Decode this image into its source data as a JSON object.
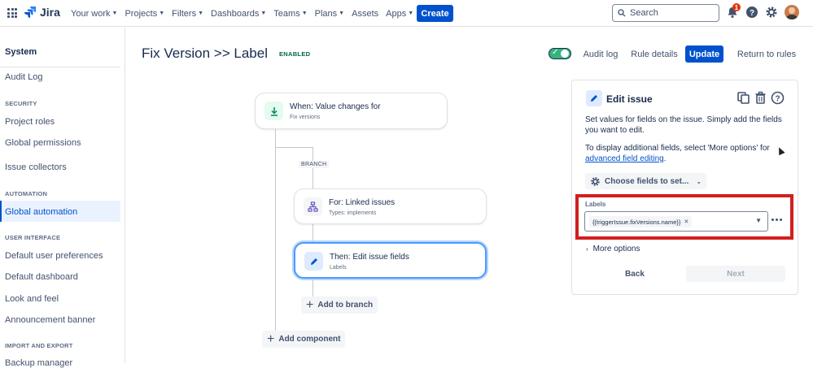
{
  "topbar": {
    "logo_text": "Jira",
    "nav": [
      {
        "label": "Your work",
        "has_dropdown": true
      },
      {
        "label": "Projects",
        "has_dropdown": true
      },
      {
        "label": "Filters",
        "has_dropdown": true
      },
      {
        "label": "Dashboards",
        "has_dropdown": true
      },
      {
        "label": "Teams",
        "has_dropdown": true
      },
      {
        "label": "Plans",
        "has_dropdown": true
      },
      {
        "label": "Assets",
        "has_dropdown": false
      },
      {
        "label": "Apps",
        "has_dropdown": true
      }
    ],
    "create_label": "Create",
    "search_placeholder": "Search",
    "notification_count": "1"
  },
  "sidebar": {
    "title": "System",
    "audit_log": "Audit Log",
    "sections": {
      "security": "SECURITY",
      "automation": "AUTOMATION",
      "user_interface": "USER INTERFACE",
      "import_export": "IMPORT AND EXPORT"
    },
    "items": {
      "project_roles": "Project roles",
      "global_permissions": "Global permissions",
      "issue_collectors": "Issue collectors",
      "global_automation": "Global automation",
      "default_user_preferences": "Default user preferences",
      "default_dashboard": "Default dashboard",
      "look_and_feel": "Look and feel",
      "announcement_banner": "Announcement banner",
      "backup_manager": "Backup manager"
    }
  },
  "rule": {
    "title": "Fix Version >> Label",
    "status": "ENABLED",
    "enabled": true,
    "buttons": {
      "audit_log": "Audit log",
      "rule_details": "Rule details",
      "update": "Update",
      "return": "Return to rules"
    }
  },
  "flow": {
    "trigger": {
      "title": "When: Value changes for",
      "subtitle": "Fix versions"
    },
    "branch_tag": "BRANCH",
    "branch": {
      "title": "For: Linked issues",
      "subtitle": "Types: implements"
    },
    "action": {
      "title": "Then: Edit issue fields",
      "subtitle": "Labels"
    },
    "add_to_branch": "Add to branch",
    "add_component": "Add component"
  },
  "panel": {
    "title": "Edit issue",
    "description": "Set values for fields on the issue. Simply add the fields you want to edit.",
    "more_text_prefix": "To display additional fields, select 'More options' for",
    "more_text_link": "advanced field editing",
    "more_text_suffix": ".",
    "choose_fields": "Choose fields to set...",
    "labels_label": "Labels",
    "labels_value": "{{triggerIssue.fixVersions.name}}",
    "more_options": "More options",
    "back": "Back",
    "next": "Next"
  },
  "colors": {
    "brand": "#0052cc",
    "enabled_green": "#006644",
    "toggle_on": "#36b37e",
    "highlight_red": "#d21f1f",
    "selected_border": "#4c9aff"
  }
}
